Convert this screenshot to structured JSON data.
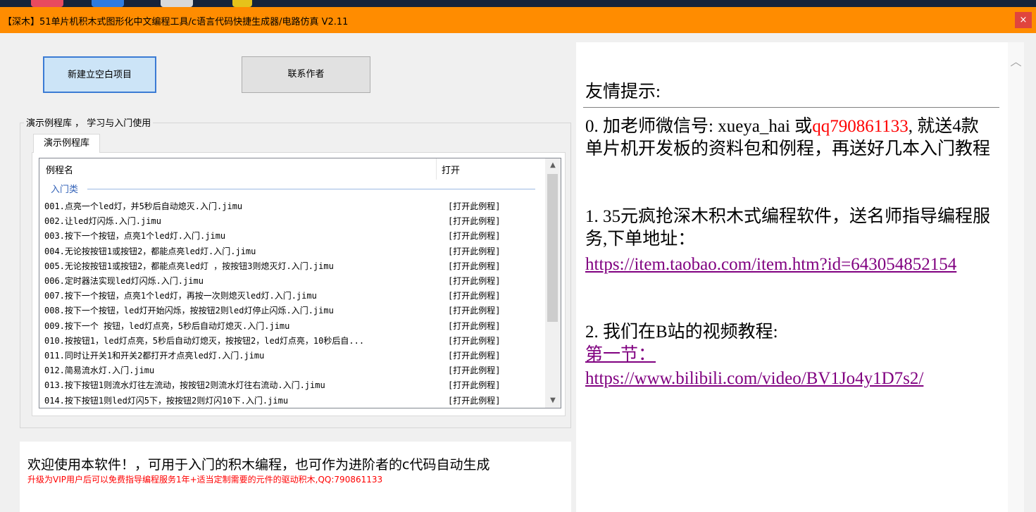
{
  "window": {
    "title": "【深木】51单片机积木式图形化中文编程工具/c语言代码快捷生成器/电路仿真  V2.11",
    "close_label": "×"
  },
  "buttons": {
    "new_project": "新建立空白项目",
    "contact_author": "联系作者"
  },
  "demo_group": {
    "legend": "演示例程库 ，  学习与入门使用",
    "tab": "演示例程库",
    "columns": [
      "例程名",
      "打开"
    ],
    "category": "入门类",
    "open_label": "[打开此例程]",
    "rows": [
      "001.点亮一个led灯，并5秒后自动熄灭.入门.jimu",
      "002.让led灯闪烁.入门.jimu",
      "003.按下一个按钮，点亮1个led灯.入门.jimu",
      "004.无论按按钮1或按钮2，都能点亮led灯.入门.jimu",
      "005.无论按按钮1或按钮2，都能点亮led灯 ，按按钮3则熄灭灯.入门.jimu",
      "006.定时器法实现led灯闪烁.入门.jimu",
      "007.按下一个按钮，点亮1个led灯，再按一次则熄灭led灯.入门.jimu",
      "008.按下一个按钮，led灯开始闪烁，按按钮2则led灯停止闪烁.入门.jimu",
      "009.按下一个 按钮，led灯点亮，5秒后自动灯熄灭.入门.jimu",
      "010.按按钮1，led灯点亮，5秒后自动灯熄灭，按按钮2，led灯点亮，10秒后自...",
      "011.同时让开关1和开关2都打开才点亮led灯.入门.jimu",
      "012.简易流水灯.入门.jimu",
      "013.按下按钮1则流水灯往左流动，按按钮2则流水灯往右流动.入门.jimu",
      "014.按下按钮1则led灯闪5下，按按钮2则灯闪10下.入门.jimu"
    ]
  },
  "welcome": {
    "main": "欢迎使用本软件！，可用于入门的积木编程，也可作为进阶者的c代码自动生成",
    "sub": "升级为VIP用户后可以免费指导编程服务1年+适当定制需要的元件的驱动积木,QQ:790861133"
  },
  "info": {
    "title": "友情提示:",
    "p0_a": "0. 加老师微信号: xueya_hai 或",
    "p0_qq": "qq790861133",
    "p0_b": ", 就送4款单片机开发板的资料包和例程，再送好几本入门教程",
    "p1_text": "1. 35元疯抢深木积木式编程软件，送名师指导编程服务,下单地址：",
    "p1_link": "https://item.taobao.com/item.htm?id=643054852154",
    "p2_text": "2. 我们在B站的视频教程:",
    "p2_section": "第一节：",
    "p2_link": "https://www.bilibili.com/video/BV1Jo4y1D7s2/"
  }
}
